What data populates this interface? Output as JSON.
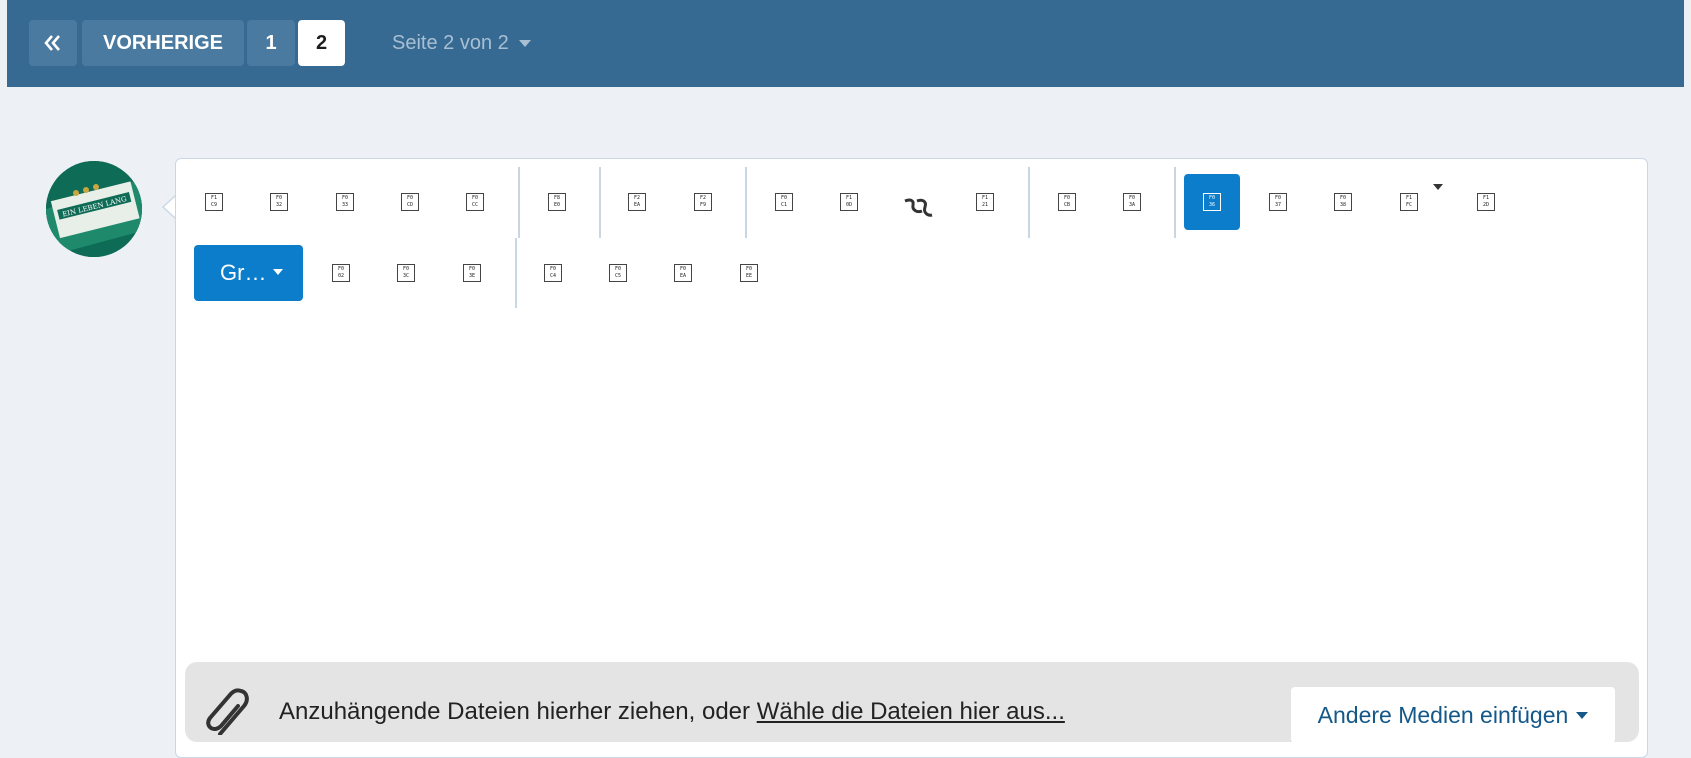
{
  "pagination": {
    "first_icon": "double-chevron-left-icon",
    "previous_label": "VORHERIGE",
    "pages": [
      "1",
      "2"
    ],
    "current_page": "2",
    "page_jump_label": "Seite 2 von 2"
  },
  "colors": {
    "pager_bg": "#366a93",
    "pager_button": "#4a7aa0",
    "accent": "#0b7dcb",
    "page_bg": "#edf1f6"
  },
  "avatar": {
    "caption": "EIN LEBEN LANG"
  },
  "toolbar": {
    "row1": [
      {
        "name": "bold-button",
        "code": [
          "F1",
          "C9"
        ],
        "icon": "bold-icon"
      },
      {
        "name": "italic-button",
        "code": [
          "F0",
          "32"
        ],
        "icon": "italic-icon"
      },
      {
        "name": "underline-button",
        "code": [
          "F0",
          "33"
        ],
        "icon": "underline-icon"
      },
      {
        "name": "strikethrough-button",
        "code": [
          "F0",
          "CD"
        ],
        "icon": "strikethrough-icon"
      },
      {
        "name": "more-text-button",
        "code": [
          "F0",
          "CC"
        ],
        "icon": "more-icon"
      },
      {
        "name": "font-color-button",
        "code": [
          "F8",
          "E0"
        ],
        "icon": "font-color-icon"
      },
      {
        "name": "font-family-button",
        "code": [
          "F2",
          "EA"
        ],
        "icon": "font-icon"
      },
      {
        "name": "font-size-button",
        "code": [
          "F2",
          "F9"
        ],
        "icon": "font-size-icon"
      },
      {
        "name": "link-button",
        "code": [
          "F0",
          "C1"
        ],
        "icon": "link-icon"
      },
      {
        "name": "image-button",
        "code": [
          "F1",
          "0D"
        ],
        "icon": "image-icon"
      },
      {
        "name": "smilie-button",
        "code": [],
        "icon": "smilie-icon"
      },
      {
        "name": "media-button",
        "code": [
          "F1",
          "21"
        ],
        "icon": "media-icon"
      },
      {
        "name": "list-button",
        "code": [
          "F0",
          "CB"
        ],
        "icon": "list-icon"
      },
      {
        "name": "table-button",
        "code": [
          "F0",
          "3A"
        ],
        "icon": "table-icon"
      },
      {
        "name": "align-left-button",
        "code": [
          "F0",
          "36"
        ],
        "icon": "align-left-icon"
      },
      {
        "name": "align-center-button",
        "code": [
          "F0",
          "37"
        ],
        "icon": "align-center-icon"
      },
      {
        "name": "align-right-button",
        "code": [
          "F0",
          "38"
        ],
        "icon": "align-right-icon"
      },
      {
        "name": "insert-dropdown-button",
        "code": [
          "F1",
          "FC"
        ],
        "icon": "insert-icon"
      },
      {
        "name": "undo-button",
        "code": [
          "F1",
          "2D"
        ],
        "icon": "undo-icon"
      }
    ],
    "heading_label": "Gr…",
    "row2": [
      {
        "name": "quote-button",
        "code": [
          "F0",
          "02"
        ],
        "icon": "quote-icon"
      },
      {
        "name": "code-button",
        "code": [
          "F0",
          "3C"
        ],
        "icon": "code-icon"
      },
      {
        "name": "spoiler-button",
        "code": [
          "F0",
          "3E"
        ],
        "icon": "spoiler-icon"
      },
      {
        "name": "draft-button",
        "code": [
          "F0",
          "C4"
        ],
        "icon": "draft-icon"
      },
      {
        "name": "preview-button",
        "code": [
          "F0",
          "C5"
        ],
        "icon": "preview-icon"
      },
      {
        "name": "fullscreen-button",
        "code": [
          "F0",
          "EA"
        ],
        "icon": "fullscreen-icon"
      },
      {
        "name": "settings-button",
        "code": [
          "F0",
          "EE"
        ],
        "icon": "settings-icon"
      }
    ]
  },
  "attachments": {
    "icon": "paperclip-icon",
    "text_prefix": "Anzuhängende Dateien hierher ziehen, oder ",
    "choose_link": "Wähle die Dateien hier aus...",
    "other_media_label": "Andere Medien einfügen"
  }
}
